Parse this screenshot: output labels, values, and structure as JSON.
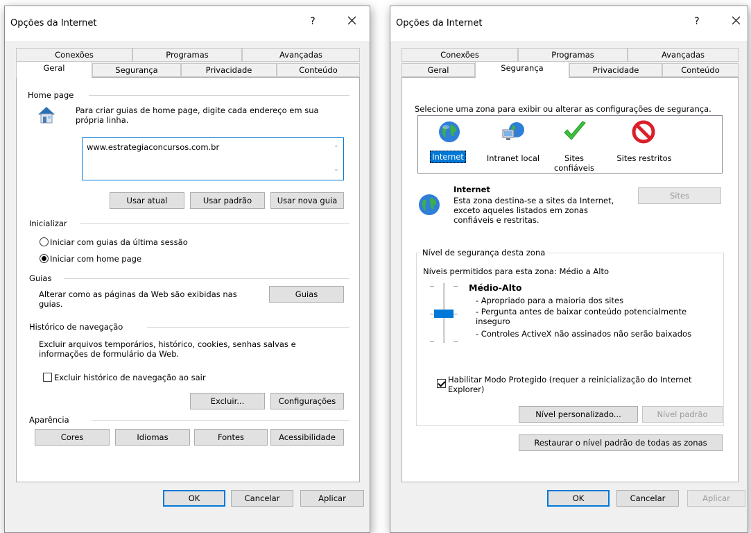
{
  "dialog_left": {
    "title": "Opções da Internet",
    "help": "?",
    "tabs_back": [
      "Conexões",
      "Programas",
      "Avançadas"
    ],
    "tabs_front": [
      "Geral",
      "Segurança",
      "Privacidade",
      "Conteúdo"
    ],
    "active_tab": "Geral",
    "home_page": {
      "group_label": "Home page",
      "description": "Para criar guias de home page, digite cada endereço em sua própria linha.",
      "url_value": "www.estrategiaconcursos.com.br",
      "btn_current": "Usar atual",
      "btn_default": "Usar padrão",
      "btn_new_tab": "Usar nova guia"
    },
    "startup": {
      "group_label": "Inicializar",
      "option_last_session": "Iniciar com guias da última sessão",
      "option_home_page": "Iniciar com home page",
      "selected": "home_page"
    },
    "tabs_group": {
      "group_label": "Guias",
      "description": "Alterar como as páginas da Web são exibidas nas guias.",
      "btn_tabs": "Guias"
    },
    "history": {
      "group_label": "Histórico de navegação",
      "description": "Excluir arquivos temporários, histórico, cookies, senhas salvas e informações de formulário da Web.",
      "checkbox_label": "Excluir histórico de navegação ao sair",
      "checkbox_checked": false,
      "btn_delete": "Excluir...",
      "btn_settings": "Configurações"
    },
    "appearance": {
      "group_label": "Aparência",
      "btn_colors": "Cores",
      "btn_languages": "Idiomas",
      "btn_fonts": "Fontes",
      "btn_accessibility": "Acessibilidade"
    },
    "footer": {
      "ok": "OK",
      "cancel": "Cancelar",
      "apply": "Aplicar"
    }
  },
  "dialog_right": {
    "title": "Opções da Internet",
    "help": "?",
    "tabs_back": [
      "Conexões",
      "Programas",
      "Avançadas"
    ],
    "tabs_front": [
      "Geral",
      "Segurança",
      "Privacidade",
      "Conteúdo"
    ],
    "active_tab": "Segurança",
    "zone_prompt": "Selecione uma zona para exibir ou alterar as configurações de segurança.",
    "zones": [
      {
        "name": "Internet",
        "icon": "globe-icon",
        "selected": true
      },
      {
        "name": "Intranet local",
        "icon": "intranet-icon",
        "selected": false
      },
      {
        "name": "Sites confiáveis",
        "icon": "checkmark-icon",
        "selected": false
      },
      {
        "name": "Sites restritos",
        "icon": "blocked-icon",
        "selected": false
      }
    ],
    "zone_info": {
      "title": "Internet",
      "description": "Esta zona destina-se a sites da Internet, exceto aqueles listados em zonas confiáveis e restritas.",
      "btn_sites": "Sites"
    },
    "security_level": {
      "group_label": "Nível de segurança desta zona",
      "allowed_levels": "Níveis permitidos para esta zona: Médio a Alto",
      "level_name": "Médio-Alto",
      "bullets": [
        "- Apropriado para a maioria dos sites",
        "- Pergunta antes de baixar conteúdo potencialmente inseguro",
        "- Controles ActiveX não assinados não serão baixados"
      ],
      "slider_position": "Médio-Alto",
      "protected_mode_label": "Habilitar Modo Protegido (requer a reinicialização do Internet Explorer)",
      "protected_mode_checked": true,
      "btn_custom": "Nível personalizado...",
      "btn_default_level": "Nível padrão"
    },
    "btn_reset_all": "Restaurar o nível padrão de todas as zonas",
    "footer": {
      "ok": "OK",
      "cancel": "Cancelar",
      "apply": "Aplicar"
    }
  },
  "colors": {
    "accent": "#0078d7",
    "dialog_bg": "#f0f0f0",
    "panel_bg": "#ffffff"
  }
}
